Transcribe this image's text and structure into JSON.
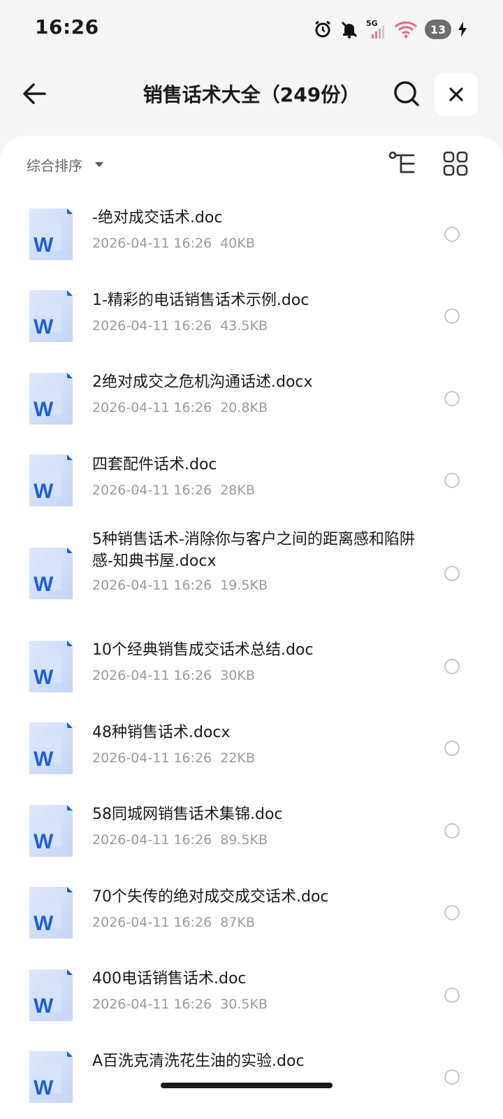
{
  "status": {
    "time": "16:26",
    "network": "5G",
    "battery": "13"
  },
  "header": {
    "title": "销售话术大全（249份）"
  },
  "toolbar": {
    "sort_label": "综合排序"
  },
  "files": [
    {
      "name": "-绝对成交话术.doc",
      "date": "2026-04-11 16:26",
      "size": "40KB"
    },
    {
      "name": "1-精彩的电话销售话术示例.doc",
      "date": "2026-04-11 16:26",
      "size": "43.5KB"
    },
    {
      "name": "2绝对成交之危机沟通话述.docx",
      "date": "2026-04-11 16:26",
      "size": "20.8KB"
    },
    {
      "name": "四套配件话术.doc",
      "date": "2026-04-11 16:26",
      "size": "28KB"
    },
    {
      "name": "5种销售话术-消除你与客户之间的距离感和陷阱感-知典书屋.docx",
      "date": "2026-04-11 16:26",
      "size": "19.5KB"
    },
    {
      "name": "10个经典销售成交话术总结.doc",
      "date": "2026-04-11 16:26",
      "size": "30KB"
    },
    {
      "name": "48种销售话术.docx",
      "date": "2026-04-11 16:26",
      "size": "22KB"
    },
    {
      "name": "58同城网销售话术集锦.doc",
      "date": "2026-04-11 16:26",
      "size": "89.5KB"
    },
    {
      "name": "70个失传的绝对成交成交话术.doc",
      "date": "2026-04-11 16:26",
      "size": "87KB"
    },
    {
      "name": "400电话销售话术.doc",
      "date": "2026-04-11 16:26",
      "size": "30.5KB"
    },
    {
      "name": "A百洗克清洗花生油的实验.doc",
      "date": "",
      "size": ""
    }
  ]
}
